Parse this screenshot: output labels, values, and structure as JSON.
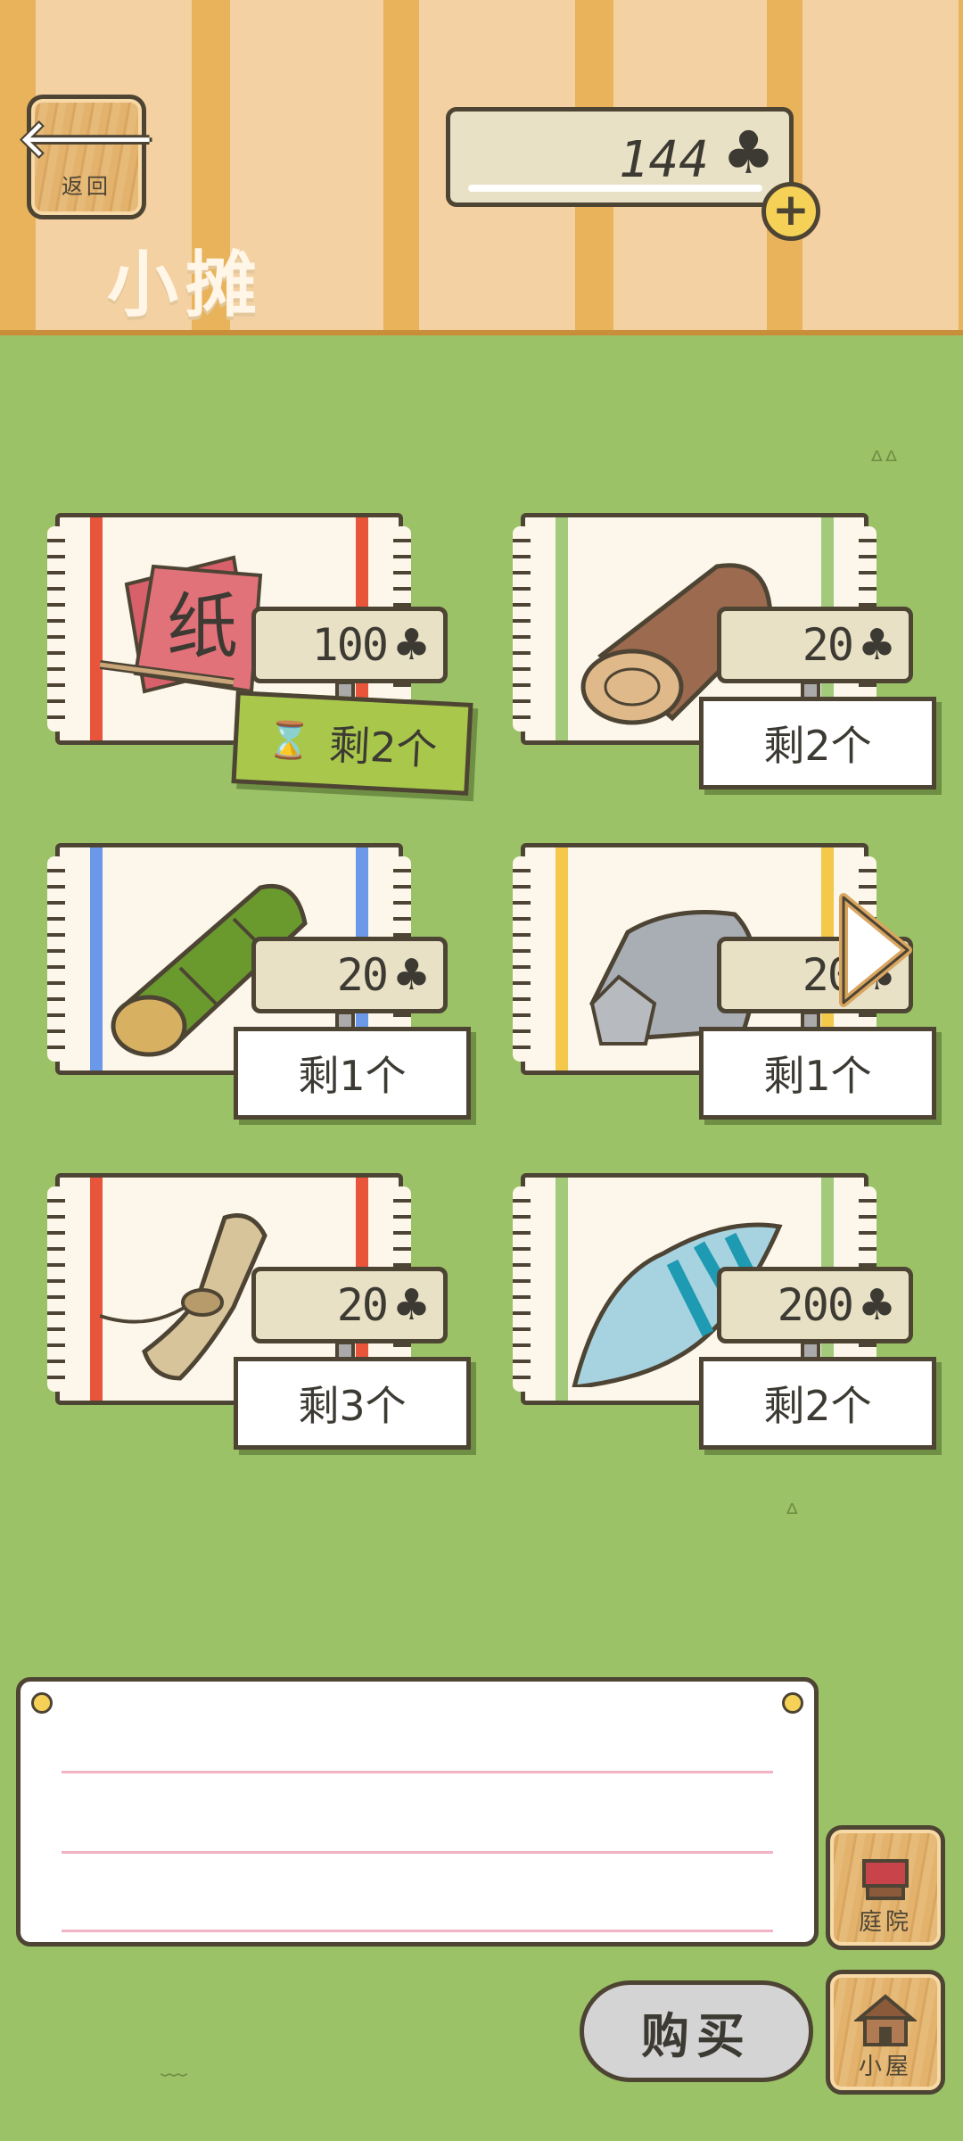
{
  "header": {
    "back_label": "返回",
    "title": "小摊",
    "clovers": "144",
    "plus_label": "+"
  },
  "items": [
    {
      "name": "paper",
      "price": "100",
      "stock": "剩2个",
      "stripe": "#e8553b",
      "limited": true
    },
    {
      "name": "wood",
      "price": "20",
      "stock": "剩2个",
      "stripe": "#a3c97a",
      "limited": false
    },
    {
      "name": "bamboo",
      "price": "20",
      "stock": "剩1个",
      "stripe": "#6b98e8",
      "limited": false
    },
    {
      "name": "stone",
      "price": "20",
      "stock": "剩1个",
      "stripe": "#f4c84a",
      "limited": false
    },
    {
      "name": "hemp",
      "price": "20",
      "stock": "剩3个",
      "stripe": "#e8553b",
      "limited": false
    },
    {
      "name": "shell",
      "price": "200",
      "stock": "剩2个",
      "stripe": "#a3c97a",
      "limited": false
    }
  ],
  "footer": {
    "yard_label": "庭院",
    "house_label": "小屋",
    "buy_label": "购买"
  },
  "colors": {
    "grass": "#9bc267",
    "outline": "#4d4434",
    "sign": "#e8e1c5"
  }
}
